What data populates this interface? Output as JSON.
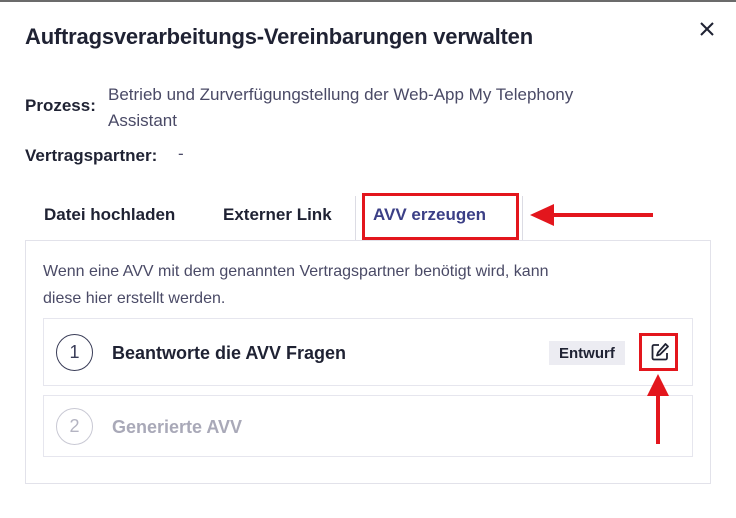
{
  "dialog": {
    "title": "Auftragsverarbeitungs-Vereinbarungen verwalten",
    "close_icon": "close-icon"
  },
  "info": {
    "process_label": "Prozess:",
    "process_value_line1": "Betrieb und Zurverfügungstellung der Web-App My Telephony",
    "process_value_line2": "Assistant",
    "partner_label": "Vertragspartner:",
    "partner_value": "-"
  },
  "tabs": [
    {
      "label": "Datei hochladen",
      "active": false
    },
    {
      "label": "Externer Link",
      "active": false
    },
    {
      "label": "AVV erzeugen",
      "active": true
    }
  ],
  "panel": {
    "description_line1": "Wenn eine AVV mit dem genannten Vertragspartner benötigt wird, kann",
    "description_line2": "diese hier erstellt werden.",
    "steps": [
      {
        "number": "1",
        "title": "Beantworte die AVV Fragen",
        "badge": "Entwurf",
        "enabled": true,
        "action_icon": "edit-icon"
      },
      {
        "number": "2",
        "title": "Generierte AVV",
        "enabled": false
      }
    ]
  },
  "colors": {
    "accent": "#3b3f86",
    "highlight": "#e3161d",
    "text": "#1f2233",
    "muted_text": "#4a4a66",
    "disabled_text": "#a9a9b8"
  }
}
